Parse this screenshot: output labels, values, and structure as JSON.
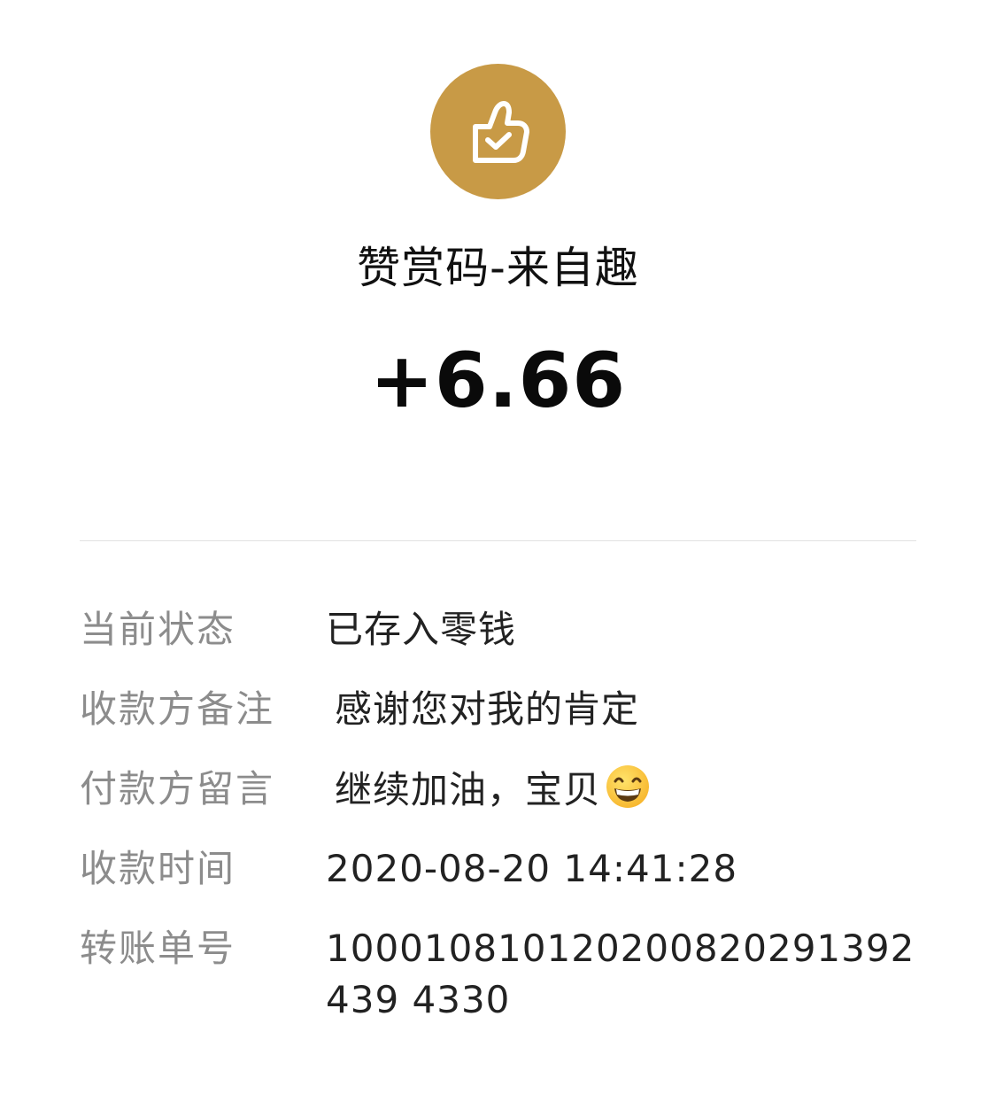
{
  "header": {
    "icon": "thumbs-up-check-icon",
    "icon_bg_color": "#c89a46",
    "title": "赞赏码-来自趣",
    "amount": "+6.66"
  },
  "details": [
    {
      "label": "当前状态",
      "value": "已存入零钱"
    },
    {
      "label": "收款方备注",
      "value": "感谢您对我的肯定"
    },
    {
      "label": "付款方留言",
      "value": "继续加油，宝贝",
      "trailing_icon": "grinning-face-emoji-icon"
    },
    {
      "label": "收款时间",
      "value": "2020-08-20 14:41:28"
    },
    {
      "label": "转账单号",
      "value": "100010810120200820291392439 4330"
    }
  ]
}
